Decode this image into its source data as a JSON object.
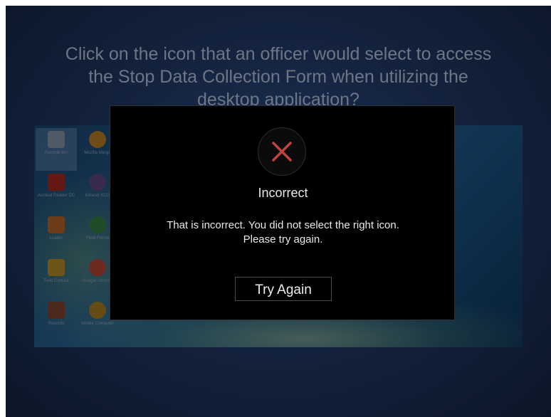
{
  "question": {
    "line1": "Click on the icon that an officer would select to access",
    "line2": "the Stop Data Collection Form when utilizing the",
    "line3": "desktop application?"
  },
  "desktop": {
    "icons": [
      {
        "label": "Recycle Bin",
        "icon": "recycle-bin-icon",
        "color": "#8fa3b8"
      },
      {
        "label": "Mozilla Merge",
        "icon": "mozilla-icon",
        "color": "#c9892a"
      },
      {
        "label": "Acrobat Reader DC",
        "icon": "pdf-icon",
        "color": "#b52b24"
      },
      {
        "label": "Intranet KCG",
        "icon": "intranet-icon",
        "color": "#6a4c8c"
      },
      {
        "label": "Leader",
        "icon": "document-icon",
        "color": "#c76e2f"
      },
      {
        "label": "Field Forms",
        "icon": "field-forms-icon",
        "color": "#3c8a4a"
      },
      {
        "label": "Field Contact",
        "icon": "field-contact-icon",
        "color": "#c79a2c"
      },
      {
        "label": "Google Chrome",
        "icon": "chrome-icon",
        "color": "#c84a3a"
      },
      {
        "label": "Records",
        "icon": "records-icon",
        "color": "#8a4a32"
      },
      {
        "label": "Mobile Computer",
        "icon": "mobile-computer-icon",
        "color": "#b88a2a"
      }
    ]
  },
  "modal": {
    "status_icon": "close-x-icon",
    "status_color": "#c0433e",
    "title": "Incorrect",
    "message_line1": "That is incorrect. You did not select the right icon.",
    "message_line2": "Please try again.",
    "button_label": "Try Again"
  }
}
